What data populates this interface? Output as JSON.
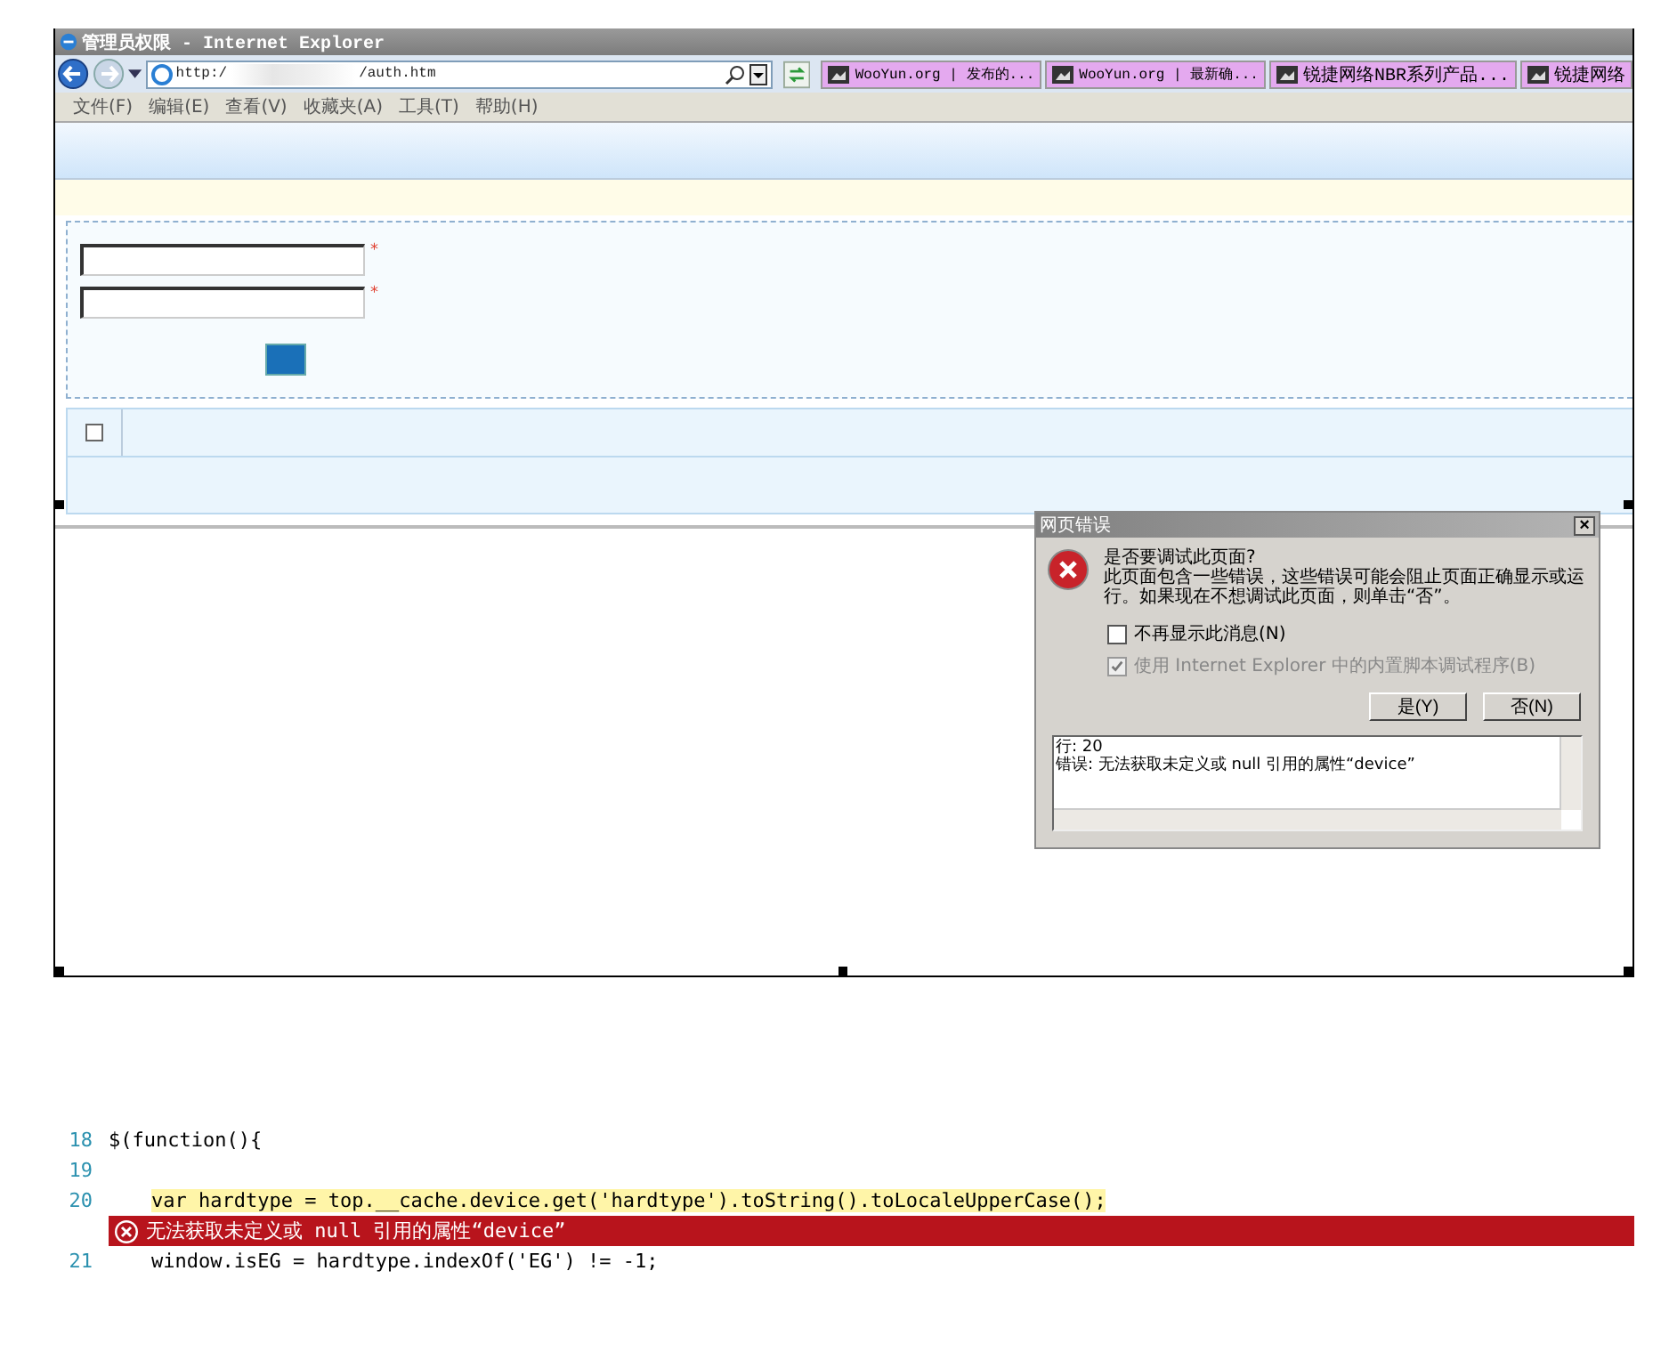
{
  "window": {
    "title": "管理员权限 - Internet Explorer"
  },
  "address_bar": {
    "prefix": "http:/",
    "suffix": "/auth.htm"
  },
  "favorites": [
    {
      "label": "WooYun.org | 发布的..."
    },
    {
      "label": "WooYun.org | 最新确..."
    },
    {
      "label": "锐捷网络NBR系列产品..."
    },
    {
      "label": "锐捷网络"
    }
  ],
  "menu": [
    "文件(F)",
    "编辑(E)",
    "查看(V)",
    "收藏夹(A)",
    "工具(T)",
    "帮助(H)"
  ],
  "form": {
    "fields": [
      {
        "required_mark": "*"
      },
      {
        "required_mark": "*"
      }
    ]
  },
  "table": {
    "header_checkbox": {
      "checked": false
    }
  },
  "dialog": {
    "title": "网页错误",
    "close": "×",
    "question": "是否要调试此页面?",
    "message": "此页面包含一些错误，这些错误可能会阻止页面正确显示或运行。如果现在不想调试此页面，则单击“否”。",
    "options": [
      {
        "label": "不再显示此消息(N)",
        "checked": false,
        "disabled": false
      },
      {
        "label": "使用 Internet Explorer 中的内置脚本调试程序(B)",
        "checked": true,
        "disabled": true
      }
    ],
    "buttons": [
      "是(Y)",
      "否(N)"
    ],
    "details": [
      "行: 20",
      "错误: 无法获取未定义或 null 引用的属性“device”"
    ]
  },
  "code": [
    {
      "kind": "code",
      "number": "18",
      "text": "$(function(){"
    },
    {
      "kind": "code",
      "number": "19"
    },
    {
      "kind": "highlight",
      "number": "20",
      "text": "var hardtype = top.__cache.device.get('hardtype').toString().toLocaleUpperCase();"
    },
    {
      "kind": "error",
      "text": "无法获取未定义或 null 引用的属性“device”"
    },
    {
      "kind": "code",
      "number": "21",
      "text": "window.isEG = hardtype.indexOf('EG') != -1;"
    }
  ]
}
